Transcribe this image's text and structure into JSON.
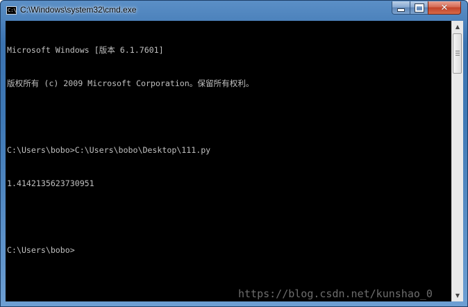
{
  "window": {
    "title": "C:\\Windows\\system32\\cmd.exe",
    "icon": "cmd-icon",
    "icon_text": "C:\\",
    "controls": {
      "minimize": "minimize-icon",
      "maximize": "maximize-icon",
      "close": "close-icon",
      "close_glyph": "✕"
    }
  },
  "console": {
    "lines": [
      "Microsoft Windows [版本 6.1.7601]",
      "版权所有 (c) 2009 Microsoft Corporation。保留所有权利。",
      "",
      "C:\\Users\\bobo>C:\\Users\\bobo\\Desktop\\111.py",
      "1.4142135623730951",
      "",
      "C:\\Users\\bobo>"
    ]
  },
  "scrollbar": {
    "up_glyph": "▲",
    "down_glyph": "▼"
  },
  "watermark": "https://blog.csdn.net/kunshao_0",
  "colors": {
    "console_bg": "#000000",
    "console_fg": "#c0c0c0",
    "titlebar": "#3f79b6",
    "close_button": "#c2432a"
  }
}
